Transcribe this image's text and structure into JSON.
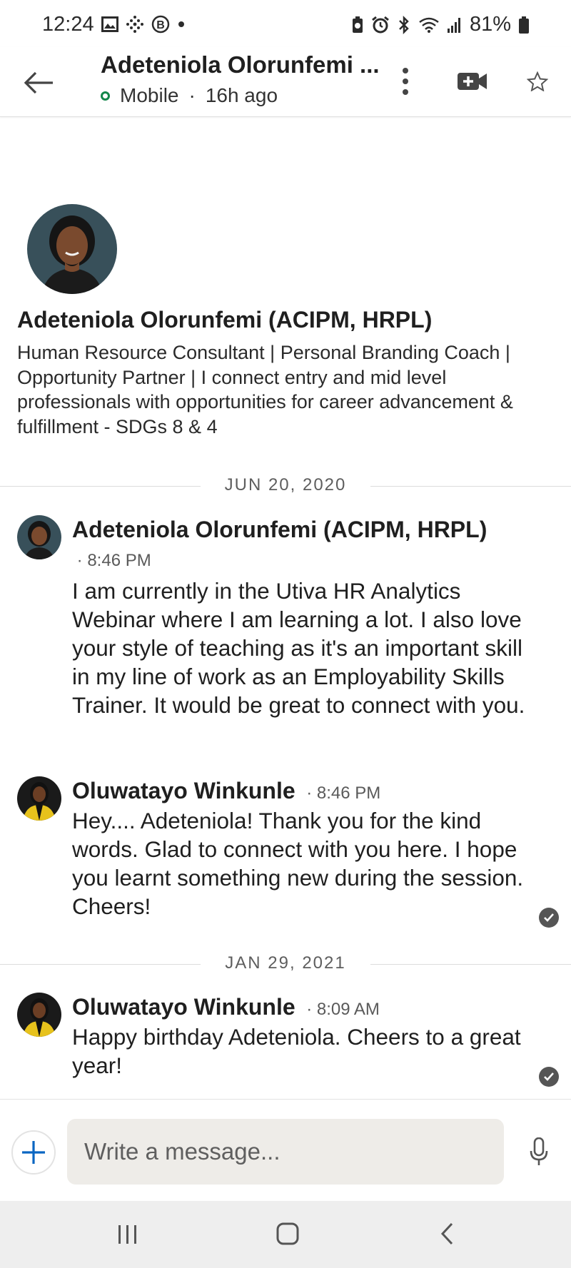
{
  "status_bar": {
    "time": "12:24",
    "battery": "81%",
    "left_icons": [
      "image-icon",
      "grid-dots-icon",
      "b-badge-icon",
      "dot-icon"
    ],
    "right_icons": [
      "battery-saver-icon",
      "alarm-icon",
      "bluetooth-icon",
      "wifi-icon",
      "signal-icon",
      "battery-icon"
    ]
  },
  "header": {
    "title": "Adeteniola Olorunfemi ...",
    "presence_status": "Mobile",
    "last_active": "16h ago",
    "presence_color": "#13864a",
    "icons": [
      "back-arrow-icon",
      "more-vertical-icon",
      "video-plus-icon",
      "star-icon"
    ]
  },
  "profile": {
    "name": "Adeteniola Olorunfemi  (ACIPM, HRPL)",
    "headline": "Human Resource Consultant | Personal Branding Coach | Opportunity Partner | I connect entry and mid level professionals with opportunities for career advancement & fulfillment - SDGs 8 & 4"
  },
  "conversation": [
    {
      "date": "JUN 20, 2020",
      "messages": [
        {
          "sender": "Adeteniola Olorunfemi  (ACIPM, HRPL)",
          "time": "8:46 PM",
          "text": "I am currently in the Utiva HR Analytics Webinar where I am learning a lot. I also love your style of teaching as it's an important skill in my line of work as an Employability Skills Trainer. It would be great to connect with you.",
          "read_receipt": false
        },
        {
          "sender": "Oluwatayo Winkunle",
          "time": "8:46 PM",
          "text": "Hey.... Adeteniola! Thank you for the kind words. Glad to connect with you here. I hope you learnt something new during the session. Cheers!",
          "read_receipt": true
        }
      ]
    },
    {
      "date": "JAN 29, 2021",
      "messages": [
        {
          "sender": "Oluwatayo Winkunle",
          "time": "8:09 AM",
          "text": "Happy birthday Adeteniola. Cheers to a great year!",
          "read_receipt": true
        }
      ]
    }
  ],
  "composer": {
    "placeholder": "Write a message...",
    "accent_color": "#0a66c2"
  },
  "nav_bar": {
    "icons": [
      "recents-icon",
      "home-icon",
      "back-icon"
    ]
  }
}
